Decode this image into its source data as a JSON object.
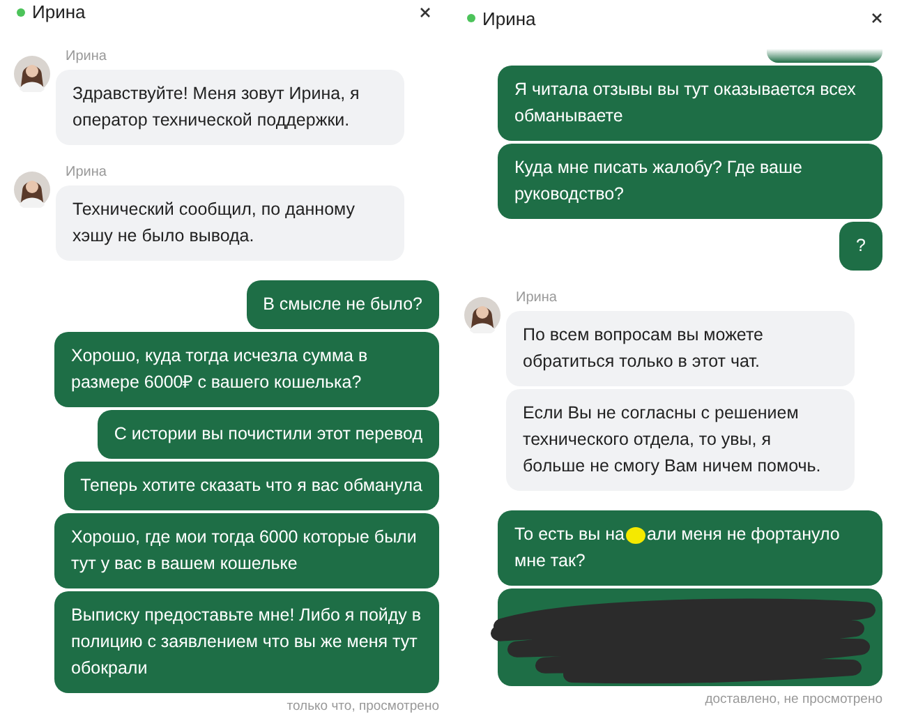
{
  "panels": [
    {
      "title": "Ирина",
      "online": true,
      "messages": [
        {
          "kind": "incoming",
          "sender": "Ирина",
          "bubbles": [
            "Здравствуйте! Меня зовут Ирина, я оператор технической поддержки."
          ]
        },
        {
          "kind": "incoming",
          "sender": "Ирина",
          "bubbles": [
            "Технический сообщил, по данному хэшу не было вывода."
          ]
        },
        {
          "kind": "outgoing",
          "parts": [
            "В смысле не было?"
          ]
        },
        {
          "kind": "outgoing",
          "parts": [
            "Хорошо, куда тогда исчезла сумма в размере 6000₽ с вашего кошелька?"
          ]
        },
        {
          "kind": "outgoing",
          "parts": [
            "С истории вы почистили этот перевод"
          ]
        },
        {
          "kind": "outgoing",
          "parts": [
            "Теперь хотите сказать что я вас обманула"
          ]
        },
        {
          "kind": "outgoing",
          "parts": [
            "Хорошо, где мои тогда 6000 которые были тут у вас в вашем кошельке"
          ]
        },
        {
          "kind": "outgoing",
          "parts": [
            "Выписку предоставьте мне! Либо я пойду в полицию с заявлением что вы же меня тут обокрали"
          ]
        }
      ],
      "status": "только что, просмотрено"
    },
    {
      "title": "Ирина",
      "online": true,
      "messages": [
        {
          "kind": "cut"
        },
        {
          "kind": "outgoing",
          "parts": [
            "Я читала отзывы вы тут оказывается всех обманываете"
          ]
        },
        {
          "kind": "outgoing",
          "parts": [
            "Куда мне писать жалобу? Где ваше руководство?"
          ]
        },
        {
          "kind": "outgoing",
          "parts": [
            "?"
          ]
        },
        {
          "kind": "incoming",
          "sender": "Ирина",
          "bubbles": [
            "По всем вопросам вы можете обратиться только в этот чат.",
            "Если Вы не согласны с решением технического отдела, то увы, я больше не смогу Вам ничем помочь."
          ]
        },
        {
          "kind": "outgoing",
          "parts": [
            "То есть вы на",
            "али меня не фортануло мне так?"
          ]
        },
        {
          "kind": "redacted"
        }
      ],
      "status": "доставлено, не просмотрено"
    }
  ]
}
